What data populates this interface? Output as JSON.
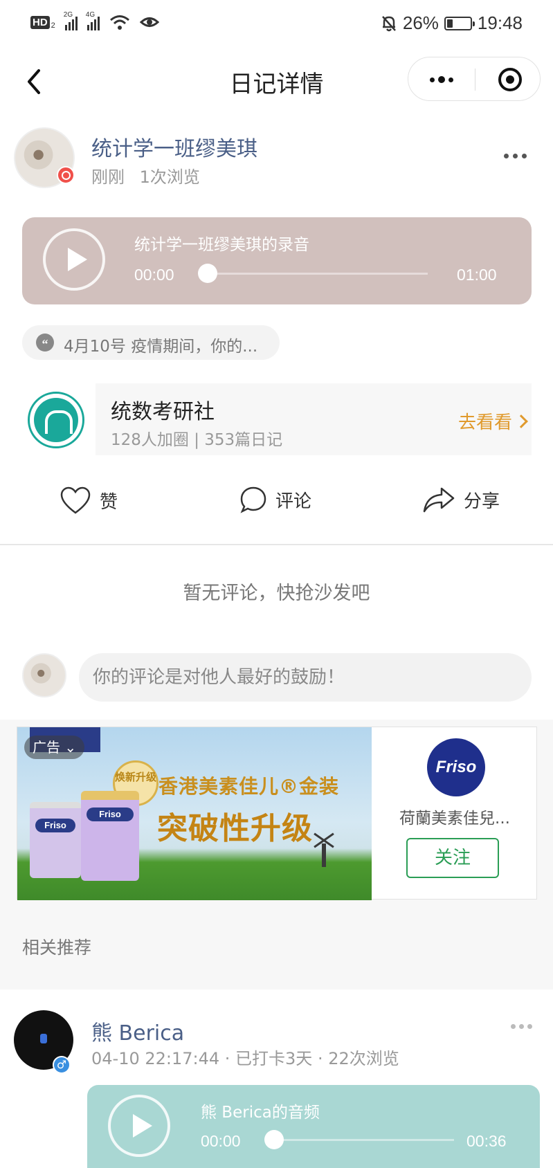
{
  "status_bar": {
    "hd_label": "HD",
    "hd_sub": "2",
    "signal1_label": "2G",
    "signal2_label": "4G",
    "battery_percent": "26%",
    "battery_level": 0.26,
    "time": "19:48",
    "icons": [
      "signal-icon",
      "wifi-icon",
      "eye-icon",
      "bell-off-icon",
      "battery-icon"
    ]
  },
  "nav": {
    "title": "日记详情",
    "back_icon": "chevron-left-icon",
    "more_icon": "more-dots-icon",
    "close_icon": "target-close-icon"
  },
  "post": {
    "author_name": "统计学一班缪美琪",
    "time": "刚刚",
    "views": "1次浏览",
    "audio": {
      "title": "统计学一班缪美琪的录音",
      "current": "00:00",
      "total": "01:00",
      "progress": 0,
      "color": "#d1c0bd"
    },
    "topic_icon_text": "“",
    "topic": "4月10号 疫情期间，你的..."
  },
  "circle": {
    "name": "统数考研社",
    "stats": "128人加圈 | 353篇日记",
    "go_label": "去看看"
  },
  "actions": {
    "like": "赞",
    "comment": "评论",
    "share": "分享"
  },
  "comments": {
    "empty_text": "暂无评论，快抢沙发吧",
    "input_placeholder": "你的评论是对他人最好的鼓励！"
  },
  "ad": {
    "tag": "广告",
    "badge": "焕新升级",
    "headline1": "香港美素佳儿®金装",
    "headline2": "突破性升级",
    "can_label": "Friso",
    "logo_text": "Friso",
    "advertiser": "荷蘭美素佳兒...",
    "follow_label": "关注"
  },
  "related": {
    "title": "相关推荐",
    "items": [
      {
        "author_name": "熊 Berica",
        "meta": "04-10 22:17:44 · 已打卡3天 · 22次浏览",
        "gender_icon": "male-icon",
        "gender_symbol": "♂",
        "audio": {
          "title": "熊 Berica的音频",
          "current": "00:00",
          "total": "00:36",
          "progress": 0,
          "color": "#a9d7d3"
        }
      }
    ]
  },
  "colors": {
    "name_blue": "#4a5f87",
    "accent_orange": "#e09a2d",
    "follow_green": "#2a9d55",
    "circle_teal": "#1aa89a"
  }
}
